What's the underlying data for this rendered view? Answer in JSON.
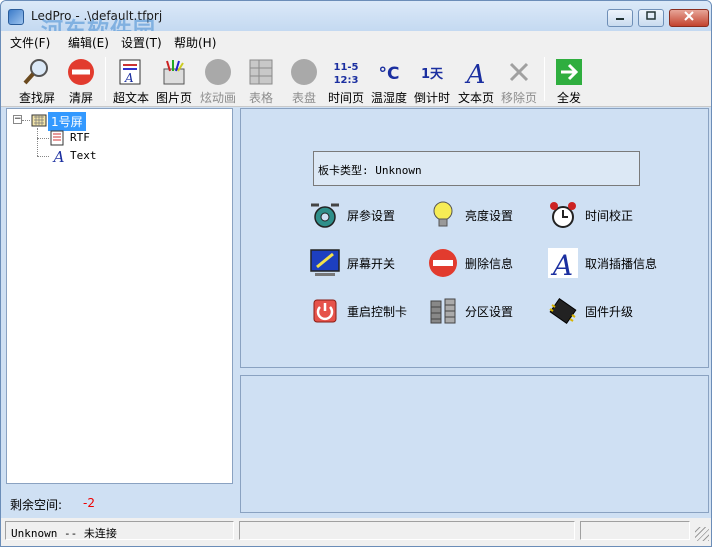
{
  "window": {
    "title": "LedPro - .\\default.tfprj",
    "watermark": "河东软件园",
    "watermark_url": "www.0359.cn",
    "controls": [
      "0",
      "1",
      "r"
    ]
  },
  "menu": [
    "文件(F)",
    "编辑(E)",
    "设置(T)",
    "帮助(H)"
  ],
  "toolbar": {
    "items": [
      {
        "label": "查找屏",
        "icon": "magnifier-icon",
        "enabled": true
      },
      {
        "label": "清屏",
        "icon": "clear-screen-icon",
        "enabled": true
      },
      {
        "label": "超文本",
        "icon": "hypertext-icon",
        "enabled": true
      },
      {
        "label": "图片页",
        "icon": "picture-page-icon",
        "enabled": true
      },
      {
        "label": "炫动画",
        "icon": "animation-icon",
        "enabled": false
      },
      {
        "label": "表格",
        "icon": "table-icon",
        "enabled": false
      },
      {
        "label": "表盘",
        "icon": "dial-icon",
        "enabled": false
      },
      {
        "label": "时间页",
        "icon": "time-page-icon",
        "enabled": true,
        "glyph": "11-5\n12:3"
      },
      {
        "label": "温湿度",
        "icon": "temperature-icon",
        "enabled": true,
        "glyph": "°C"
      },
      {
        "label": "倒计时",
        "icon": "countdown-icon",
        "enabled": true,
        "glyph": "1天"
      },
      {
        "label": "文本页",
        "icon": "text-page-icon",
        "enabled": true,
        "glyph": "A"
      },
      {
        "label": "移除页",
        "icon": "remove-page-icon",
        "enabled": false
      },
      {
        "label": "全发",
        "icon": "send-all-icon",
        "enabled": true
      }
    ]
  },
  "tree": {
    "root": "1号屏",
    "children": [
      "RTF",
      "Text"
    ]
  },
  "left_footer": {
    "label": "剩余空间:",
    "value": "-2"
  },
  "panel": {
    "card_type": "板卡类型: Unknown",
    "functions": [
      {
        "label": "屏参设置",
        "icon": "gear-icon"
      },
      {
        "label": "亮度设置",
        "icon": "lightbulb-icon"
      },
      {
        "label": "时间校正",
        "icon": "alarm-clock-icon"
      },
      {
        "label": "屏幕开关",
        "icon": "monitor-icon"
      },
      {
        "label": "删除信息",
        "icon": "delete-icon"
      },
      {
        "label": "取消插播信息",
        "icon": "italic-a-icon"
      },
      {
        "label": "重启控制卡",
        "icon": "power-icon"
      },
      {
        "label": "分区设置",
        "icon": "partition-icon"
      },
      {
        "label": "固件升级",
        "icon": "chip-icon"
      }
    ]
  },
  "status": {
    "connection": "Unknown -- 未连接"
  },
  "colors": {
    "panel_bg": "#cfe0f3",
    "selection": "#3399ff",
    "negative": "#ee0000"
  }
}
